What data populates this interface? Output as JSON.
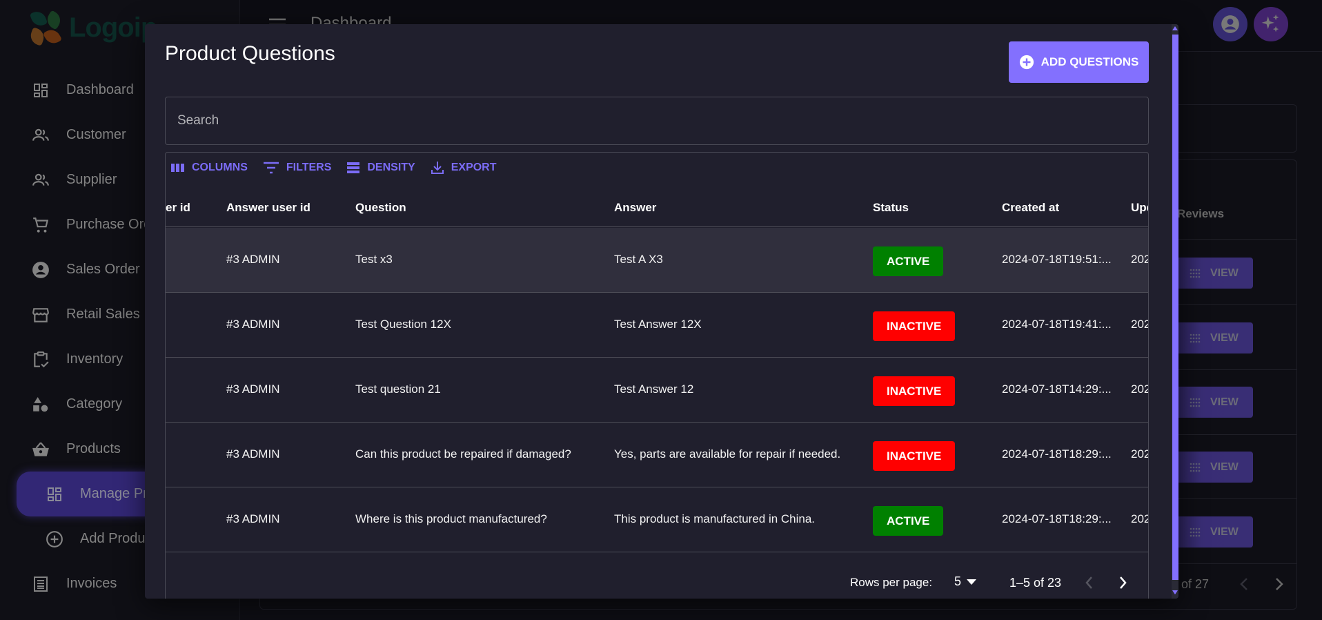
{
  "app": {
    "logo_text": "Logoip",
    "page_title": "Dashboard"
  },
  "sidebar": {
    "items": [
      {
        "label": "Dashboard",
        "icon": "dashboard-icon"
      },
      {
        "label": "Customer",
        "icon": "people-icon"
      },
      {
        "label": "Supplier",
        "icon": "people-icon"
      },
      {
        "label": "Purchase Order",
        "icon": "cart-icon"
      },
      {
        "label": "Sales Order",
        "icon": "account-circle-icon"
      },
      {
        "label": "Retail Sales",
        "icon": "storefront-icon"
      },
      {
        "label": "Inventory",
        "icon": "clipboard-check-icon"
      },
      {
        "label": "Category",
        "icon": "shapes-icon"
      },
      {
        "label": "Products",
        "icon": "basket-icon"
      },
      {
        "label": "Manage Products",
        "icon": "dashboard-icon",
        "active": true,
        "sub": true
      },
      {
        "label": "Add Product",
        "icon": "add-circle-icon",
        "sub": true
      },
      {
        "label": "Invoices",
        "icon": "receipt-icon"
      }
    ]
  },
  "background": {
    "reviews_label": "Reviews",
    "view_label": "VIEW",
    "pager_text": "of 27"
  },
  "modal": {
    "title": "Product Questions",
    "add_button": "ADD QUESTIONS",
    "search_placeholder": "Search",
    "toolbar": {
      "columns": "COLUMNS",
      "filters": "FILTERS",
      "density": "DENSITY",
      "export": "EXPORT"
    },
    "columns": [
      "er id",
      "Answer user id",
      "Question",
      "Answer",
      "Status",
      "Created at",
      "Upd"
    ],
    "rows": [
      {
        "answer_user": "#3 ADMIN",
        "question": "Test x3",
        "answer": "Test A X3",
        "status": "ACTIVE",
        "created_at": "2024-07-18T19:51:...",
        "updated_at": "202"
      },
      {
        "answer_user": "#3 ADMIN",
        "question": "Test Question 12X",
        "answer": "Test Answer 12X",
        "status": "INACTIVE",
        "created_at": "2024-07-18T19:41:...",
        "updated_at": "202"
      },
      {
        "answer_user": "#3 ADMIN",
        "question": "Test question 21",
        "answer": "Test Answer 12",
        "status": "INACTIVE",
        "created_at": "2024-07-18T14:29:...",
        "updated_at": "202"
      },
      {
        "answer_user": "#3 ADMIN",
        "question": "Can this product be repaired if damaged?",
        "answer": "Yes, parts are available for repair if needed.",
        "status": "INACTIVE",
        "created_at": "2024-07-18T18:29:...",
        "updated_at": "202"
      },
      {
        "answer_user": "#3 ADMIN",
        "question": "Where is this product manufactured?",
        "answer": "This product is manufactured in China.",
        "status": "ACTIVE",
        "created_at": "2024-07-18T18:29:...",
        "updated_at": "202"
      }
    ],
    "footer": {
      "rows_per_page_label": "Rows per page:",
      "rows_per_page_value": "5",
      "range": "1–5 of 23"
    }
  },
  "colors": {
    "accent": "#8370fe",
    "active": "#008000",
    "inactive": "#ff0000",
    "modal_bg": "#201f2d"
  }
}
